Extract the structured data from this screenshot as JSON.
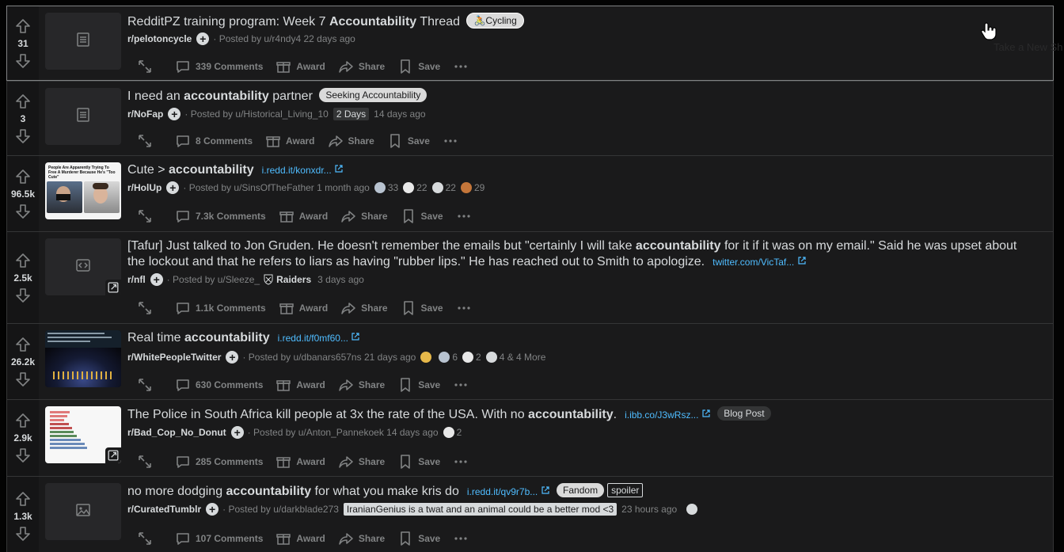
{
  "labels": {
    "award": "Award",
    "share": "Share",
    "save": "Save",
    "posted_by": "Posted by"
  },
  "ghost_tooltip": "Take a New Sh",
  "posts": [
    {
      "score": "31",
      "title_pre": "RedditPZ training program: Week 7 ",
      "title_bold": "Accountability",
      "title_post": " Thread",
      "flair": "🚴Cycling",
      "subreddit": "r/pelotoncycle",
      "user": "u/r4ndy4",
      "time": "22 days ago",
      "comments": "339 Comments"
    },
    {
      "score": "3",
      "title_pre": "I need an ",
      "title_bold": "accountability",
      "title_post": " partner",
      "flair": "Seeking Accountability",
      "subreddit": "r/NoFap",
      "user": "u/Historical_Living_10",
      "user_flair": "2 Days",
      "time": "14 days ago",
      "comments": "8 Comments"
    },
    {
      "score": "96.5k",
      "title_pre": "Cute > ",
      "title_bold": "accountability",
      "title_post": "",
      "domain": "i.redd.it/konxdr...",
      "subreddit": "r/HolUp",
      "user": "u/SinsOfTheFather",
      "time": "1 month ago",
      "awards": [
        "33",
        "22",
        "22",
        "29"
      ],
      "comments": "7.3k Comments",
      "thumb_caption": "People Are Apparently Trying To Free A Murderer Because He's \"Too Cute\""
    },
    {
      "score": "2.5k",
      "title_pre": "[Tafur] Just talked to Jon Gruden. He doesn't remember the emails but \"certainly I will take ",
      "title_bold": "accountability",
      "title_post": " for it if it was on my email.\" Said he was upset about the lockout and that he refers to liars as having \"rubber lips.\" He has reached out to Smith to apologize.",
      "domain": "twitter.com/VicTaf...",
      "subreddit": "r/nfl",
      "user": "u/Sleeze_",
      "user_flair": "Raiders",
      "time": "3 days ago",
      "comments": "1.1k Comments"
    },
    {
      "score": "26.2k",
      "title_pre": "Real time ",
      "title_bold": "accountability",
      "title_post": "",
      "domain": "i.redd.it/f0mf60...",
      "subreddit": "r/WhitePeopleTwitter",
      "user": "u/dbanars657ns",
      "time": "21 days ago",
      "awards": [
        "6",
        "2"
      ],
      "more_awards": "4 & 4 More",
      "comments": "630 Comments"
    },
    {
      "score": "2.9k",
      "title_pre": "The Police in South Africa kill people at 3x the rate of the USA. With no ",
      "title_bold": "accountability",
      "title_post": ".",
      "domain": "i.ibb.co/J3wRsz...",
      "flair": "Blog Post",
      "subreddit": "r/Bad_Cop_No_Donut",
      "user": "u/Anton_Pannekoek",
      "time": "14 days ago",
      "awards": [
        "2"
      ],
      "comments": "285 Comments"
    },
    {
      "score": "1.3k",
      "title_pre": "no more dodging ",
      "title_bold": "accountability",
      "title_post": " for what you make kris do",
      "domain": "i.redd.it/qv9r7b...",
      "flair": "Fandom",
      "spoiler": "spoiler",
      "subreddit": "r/CuratedTumblr",
      "user": "u/darkblade273",
      "user_flair": "IranianGenius is a twat and an animal could be a better mod <3",
      "time": "23 hours ago",
      "comments": "107 Comments"
    }
  ]
}
